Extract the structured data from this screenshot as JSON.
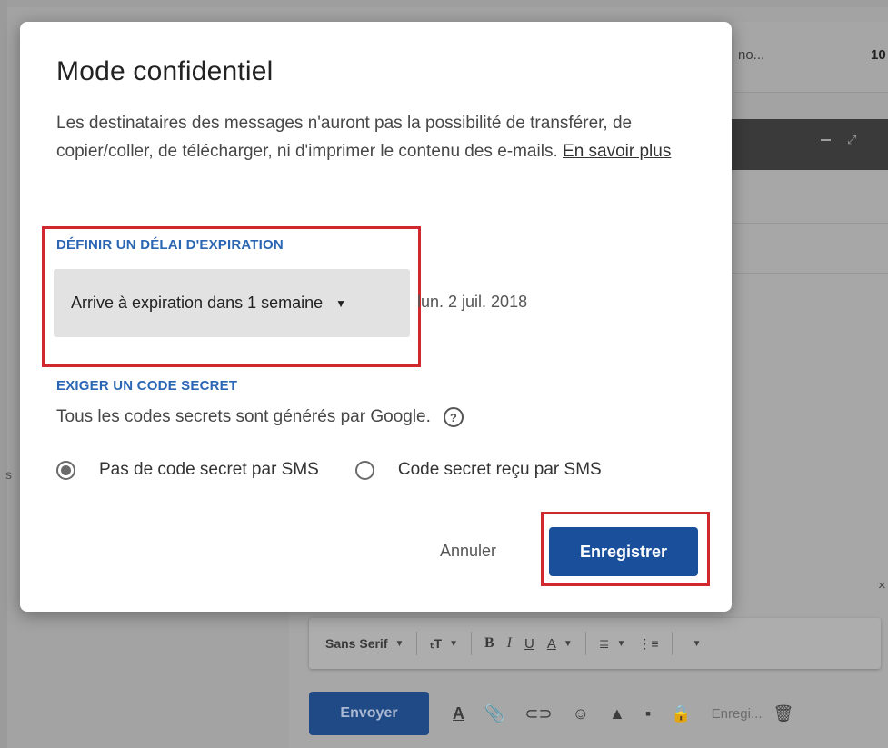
{
  "background": {
    "inbox_row_text": "no...",
    "inbox_row_number": "10",
    "side_letter": "s",
    "format_bar": {
      "font_name": "Sans Serif",
      "size_icon": "text-size-icon",
      "bold": "B",
      "italic": "I",
      "underline": "U",
      "text_color": "A"
    },
    "send_label": "Envoyer",
    "draft_label": "Enregi..."
  },
  "dialog": {
    "title": "Mode confidentiel",
    "description": "Les destinataires des messages n'auront pas la possibilité de transférer, de copier/coller, de télécharger, ni d'imprimer le contenu des e-mails.",
    "learn_more": "En savoir plus",
    "expiry": {
      "label": "DÉFINIR UN DÉLAI D'EXPIRATION",
      "selected": "Arrive à expiration dans 1 semaine",
      "date": "lun. 2 juil. 2018"
    },
    "secret": {
      "label": "EXIGER UN CODE SECRET",
      "description": "Tous les codes secrets sont générés par Google.",
      "option_no_sms": "Pas de code secret par SMS",
      "option_sms": "Code secret reçu par SMS",
      "selected": "option_no_sms"
    },
    "cancel_label": "Annuler",
    "save_label": "Enregistrer"
  },
  "colors": {
    "accent_blue": "#2a66b3",
    "save_button": "#1a4f9c",
    "highlight_red": "#d0282e"
  }
}
